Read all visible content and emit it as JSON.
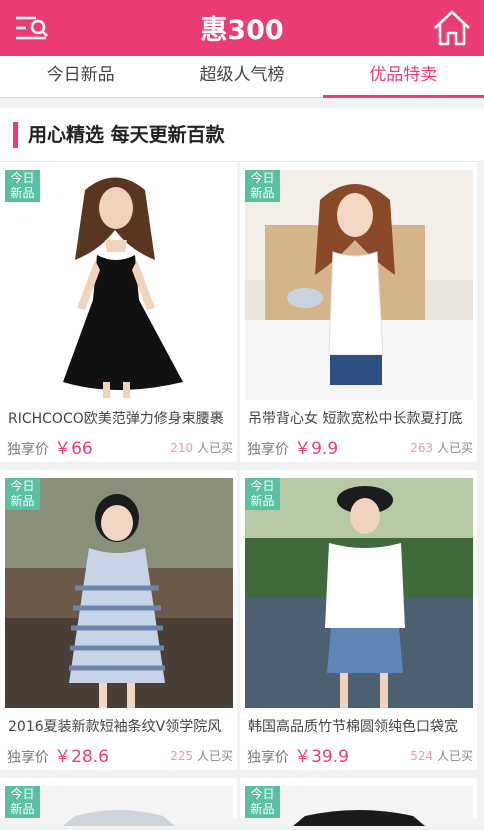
{
  "header": {
    "title": "惠300",
    "menu_icon": "menu-icon",
    "home_icon": "home-icon",
    "color": "#ea3d74"
  },
  "tabs": [
    {
      "label": "今日新品"
    },
    {
      "label": "超级人气榜"
    },
    {
      "label": "优品特卖",
      "active": true
    }
  ],
  "section": {
    "title": "用心精选  每天更新百款"
  },
  "products": [
    {
      "badge": "今日\n新品",
      "name": "RICHCOCO欧美范弹力修身束腰裹",
      "price_label": "独享价",
      "price": "￥66",
      "sold_count": "210",
      "sold_suffix": "人已买"
    },
    {
      "badge": "今日\n新品",
      "name": "吊带背心女 短款宽松中长款夏打底",
      "price_label": "独享价",
      "price": "￥9.9",
      "sold_count": "263",
      "sold_suffix": "人已买"
    },
    {
      "badge": "今日\n新品",
      "name": "2016夏装新款短袖条纹V领学院风",
      "price_label": "独享价",
      "price": "￥28.6",
      "sold_count": "225",
      "sold_suffix": "人已买"
    },
    {
      "badge": "今日\n新品",
      "name": "韩国高品质竹节棉圆领纯色口袋宽",
      "price_label": "独享价",
      "price": "￥39.9",
      "sold_count": "524",
      "sold_suffix": "人已买"
    }
  ],
  "partial_badges": [
    "今日\n新品",
    "今日\n新品"
  ]
}
